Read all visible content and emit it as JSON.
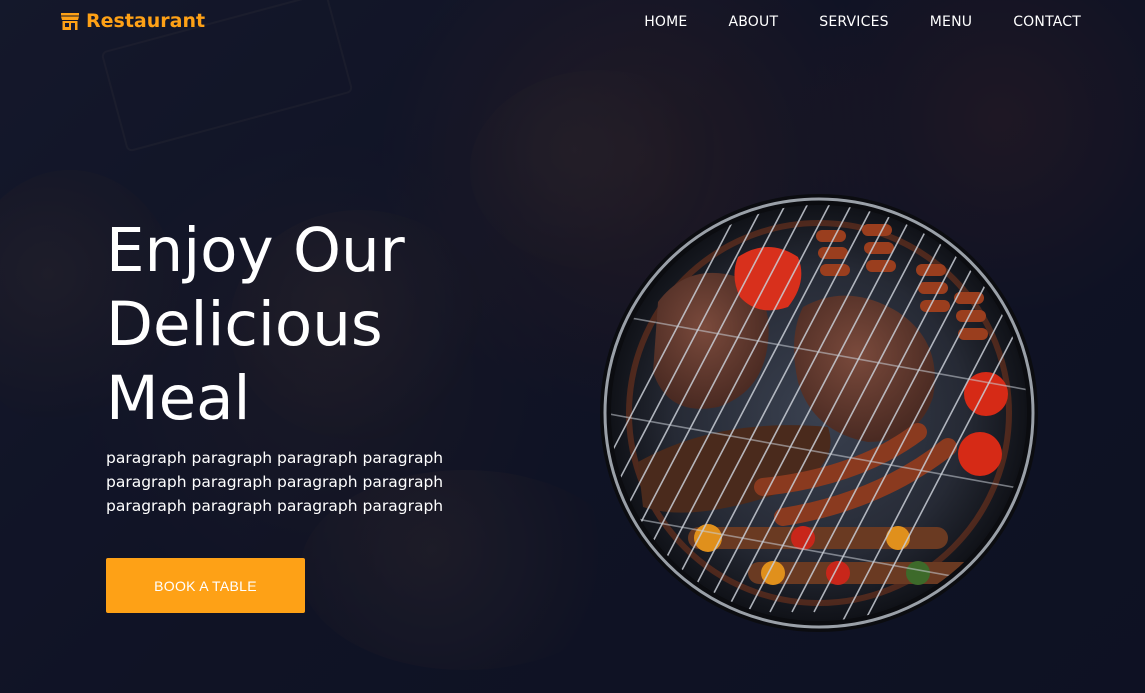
{
  "brand": {
    "name": "Restaurant",
    "icon": "storefront-icon",
    "color": "#fea116"
  },
  "nav": {
    "items": [
      {
        "label": "HOME"
      },
      {
        "label": "ABOUT"
      },
      {
        "label": "SERVICES"
      },
      {
        "label": "MENU"
      },
      {
        "label": "CONTACT"
      }
    ]
  },
  "hero": {
    "title_lines": [
      "Enjoy Our",
      "Delicious",
      "Meal"
    ],
    "paragraph_lines": [
      "paragraph paragraph paragraph paragraph",
      "paragraph paragraph paragraph paragraph",
      "paragraph paragraph paragraph paragraph"
    ],
    "cta_label": "BOOK A TABLE",
    "image_subject": "grill-with-bbq-food"
  },
  "colors": {
    "accent": "#fea116",
    "background": "#151830",
    "text": "#ffffff"
  }
}
